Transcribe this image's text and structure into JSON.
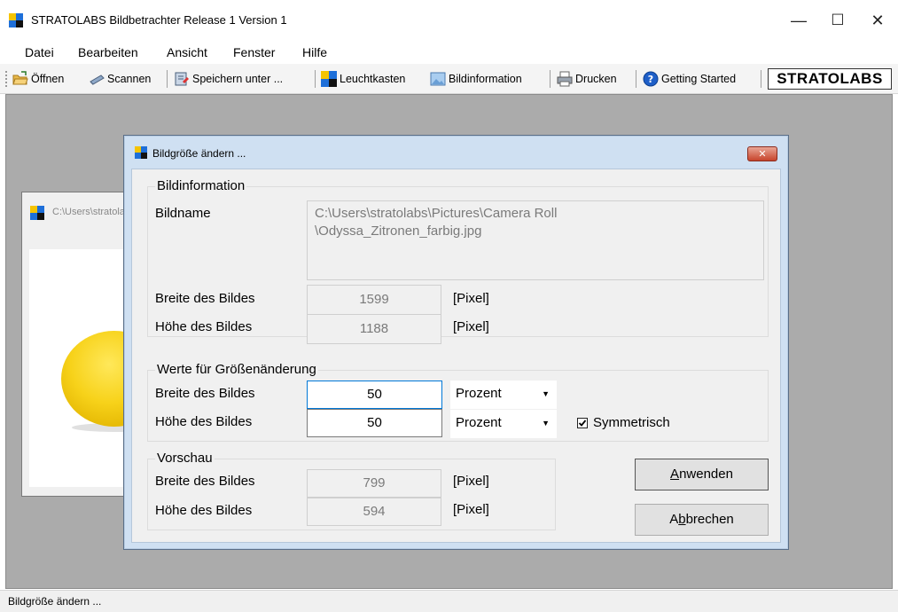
{
  "window": {
    "title": "STRATOLABS Bildbetrachter Release 1 Version 1",
    "minimize_glyph": "—",
    "maximize_glyph": "☐",
    "close_glyph": "✕"
  },
  "menu": {
    "items": [
      "Datei",
      "Bearbeiten",
      "Ansicht",
      "Fenster",
      "Hilfe"
    ]
  },
  "toolbar": {
    "open_label": "Öffnen",
    "scan_label": "Scannen",
    "save_as_label": "Speichern unter ...",
    "lightbox_label": "Leuchtkasten",
    "image_info_label": "Bildinformation",
    "print_label": "Drucken",
    "getting_started_label": "Getting Started",
    "brand": "STRATOLABS"
  },
  "child_window": {
    "title": "C:\\Users\\stratolabs\\Pictures\\Camera Roll\\Odyssa_Zitronen_farbig.jpg"
  },
  "dialog": {
    "title": "Bildgröße ändern ...",
    "close_glyph": "✕",
    "info_group": {
      "legend": "Bildinformation",
      "name_label": "Bildname",
      "name_line1": "C:\\Users\\stratolabs\\Pictures\\Camera Roll",
      "name_line2": "\\Odyssa_Zitronen_farbig.jpg",
      "width_label": "Breite des Bildes",
      "width_value": "1599",
      "width_unit": "[Pixel]",
      "height_label": "Höhe des Bildes",
      "height_value": "1188",
      "height_unit": "[Pixel]"
    },
    "resize_group": {
      "legend": "Werte für Größenänderung",
      "width_label": "Breite des Bildes",
      "width_value": "50",
      "width_unit": "Prozent",
      "height_label": "Höhe des Bildes",
      "height_value": "50",
      "height_unit": "Prozent",
      "symmetric_label": "Symmetrisch",
      "symmetric_checked": true
    },
    "preview_group": {
      "legend": "Vorschau",
      "width_label": "Breite des Bildes",
      "width_value": "799",
      "width_unit": "[Pixel]",
      "height_label": "Höhe des Bildes",
      "height_value": "594",
      "height_unit": "[Pixel]"
    },
    "apply_pre": "",
    "apply_key": "A",
    "apply_post": "nwenden",
    "cancel_pre": "A",
    "cancel_key": "b",
    "cancel_post": "brechen"
  },
  "status": {
    "text": "Bildgröße ändern ..."
  },
  "colors": {
    "dialog_frame": "#cfe0f2",
    "workspace": "#ababab",
    "focus_border": "#0078d7",
    "close_red": "#c7442c"
  }
}
